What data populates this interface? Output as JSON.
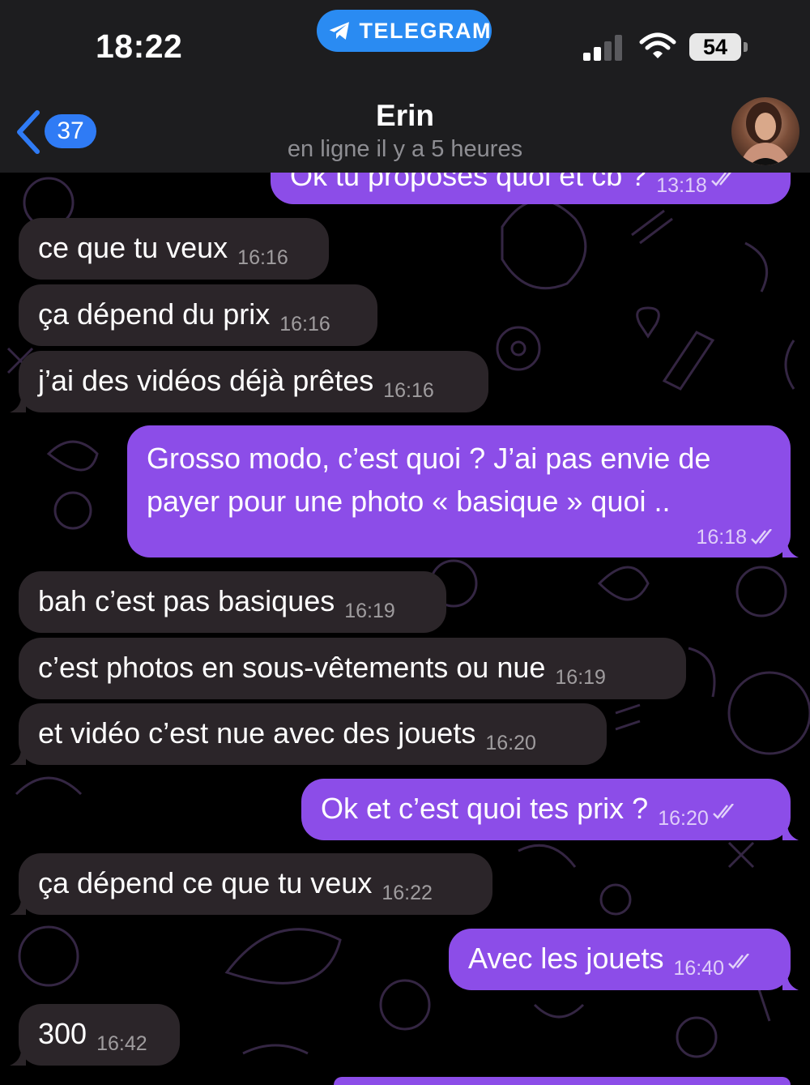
{
  "status_bar": {
    "time": "18:22",
    "app_pill": "TELEGRAM",
    "battery": "54"
  },
  "header": {
    "unread_count": "37",
    "contact_name": "Erin",
    "contact_status": "en ligne il y a 5 heures"
  },
  "colors": {
    "incoming_bubble": "#2b2529",
    "outgoing_bubble": "#8c4de8",
    "accent": "#2f7bf5"
  },
  "messages": [
    {
      "direction": "out",
      "text": "Ok tu proposes quoi et cb ?",
      "time": "13:18",
      "read": true
    },
    {
      "direction": "in",
      "text": "ce que tu veux",
      "time": "16:16"
    },
    {
      "direction": "in",
      "text": "ça dépend du prix",
      "time": "16:16"
    },
    {
      "direction": "in",
      "text": "j’ai des vidéos déjà prêtes",
      "time": "16:16"
    },
    {
      "direction": "out",
      "line1": "Grosso modo, c’est quoi ? J’ai pas envie de",
      "line2": "payer pour une photo «  basique » quoi ..",
      "time": "16:18",
      "read": true
    },
    {
      "direction": "in",
      "text": "bah c’est pas basiques",
      "time": "16:19"
    },
    {
      "direction": "in",
      "text": "c’est photos en sous-vêtements ou nue",
      "time": "16:19"
    },
    {
      "direction": "in",
      "text": "et vidéo c’est nue avec des jouets",
      "time": "16:20"
    },
    {
      "direction": "out",
      "text": "Ok et c’est quoi tes prix ?",
      "time": "16:20",
      "read": true
    },
    {
      "direction": "in",
      "text": "ça dépend ce que tu veux",
      "time": "16:22"
    },
    {
      "direction": "out",
      "text": "Avec les jouets",
      "time": "16:40",
      "read": true
    },
    {
      "direction": "in",
      "text": "300",
      "time": "16:42"
    }
  ]
}
